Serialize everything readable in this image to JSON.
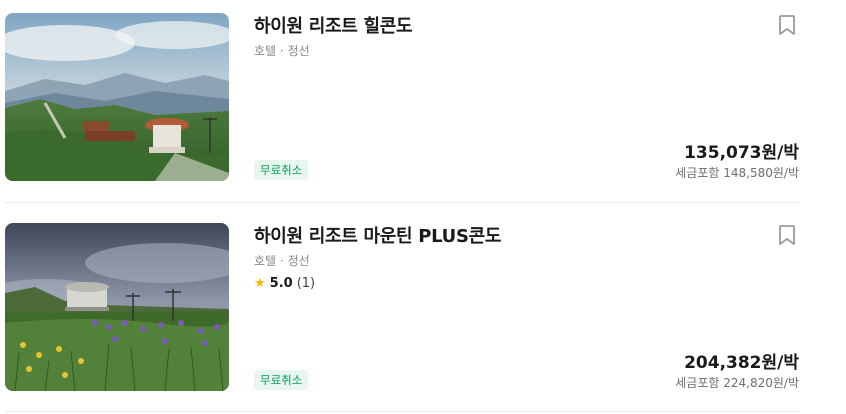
{
  "listings": [
    {
      "name": "하이원 리조트 힐콘도",
      "category": "호텔",
      "separator": "·",
      "location": "정선",
      "badge": "무료취소",
      "price": "135,073원/박",
      "price_with_tax": "세금포함 148,580원/박",
      "bookmark_icon": "bookmark-icon",
      "image": "mountain-resort-photo"
    },
    {
      "name": "하이원 리조트 마운틴 PLUS콘도",
      "category": "호텔",
      "separator": "·",
      "location": "정선",
      "rating_score": "5.0",
      "rating_count": "(1)",
      "rating_icon": "star-icon",
      "badge": "무료취소",
      "price": "204,382원/박",
      "price_with_tax": "세금포함 224,820원/박",
      "bookmark_icon": "bookmark-icon",
      "image": "mountain-flowers-photo"
    }
  ],
  "colors": {
    "badge_bg": "#e7f6ef",
    "badge_text": "#0f9a5f",
    "star": "#ffb400",
    "muted": "#8a8a8a"
  }
}
